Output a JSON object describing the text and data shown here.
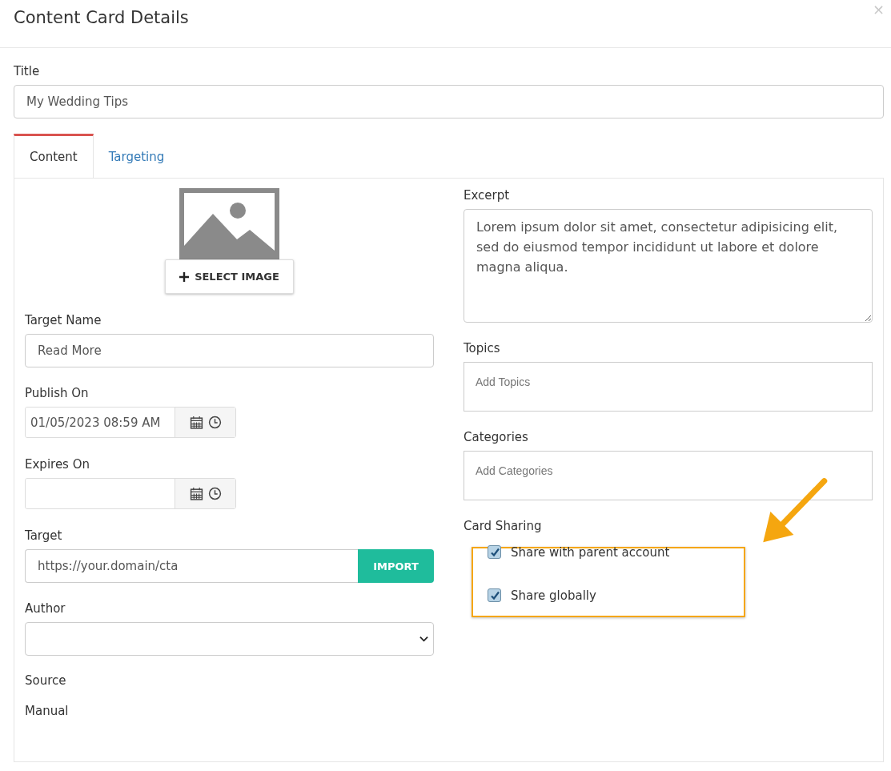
{
  "dialog": {
    "title": "Content Card Details",
    "close": "×"
  },
  "title_field": {
    "label": "Title",
    "value": "My Wedding Tips"
  },
  "tabs": [
    {
      "label": "Content",
      "selected": true
    },
    {
      "label": "Targeting",
      "selected": false
    }
  ],
  "image": {
    "button": "SELECT IMAGE"
  },
  "target_name": {
    "label": "Target Name",
    "value": "Read More"
  },
  "publish_on": {
    "label": "Publish On",
    "value": "01/05/2023 08:59 AM"
  },
  "expires_on": {
    "label": "Expires On"
  },
  "target": {
    "label": "Target",
    "value": "https://your.domain/cta",
    "button": "IMPORT"
  },
  "author": {
    "label": "Author"
  },
  "source": {
    "label": "Source",
    "value": "Manual"
  },
  "excerpt": {
    "label": "Excerpt",
    "value": "Lorem ipsum dolor sit amet, consectetur adipisicing elit, sed do eiusmod tempor incididunt ut labore et dolore magna aliqua."
  },
  "topics": {
    "label": "Topics",
    "placeholder": "Add Topics"
  },
  "categories": {
    "label": "Categories",
    "placeholder": "Add Categories"
  },
  "card_sharing": {
    "label": "Card Sharing",
    "options": [
      {
        "label": "Share with parent account",
        "checked": true
      },
      {
        "label": "Share globally",
        "checked": true
      }
    ]
  }
}
